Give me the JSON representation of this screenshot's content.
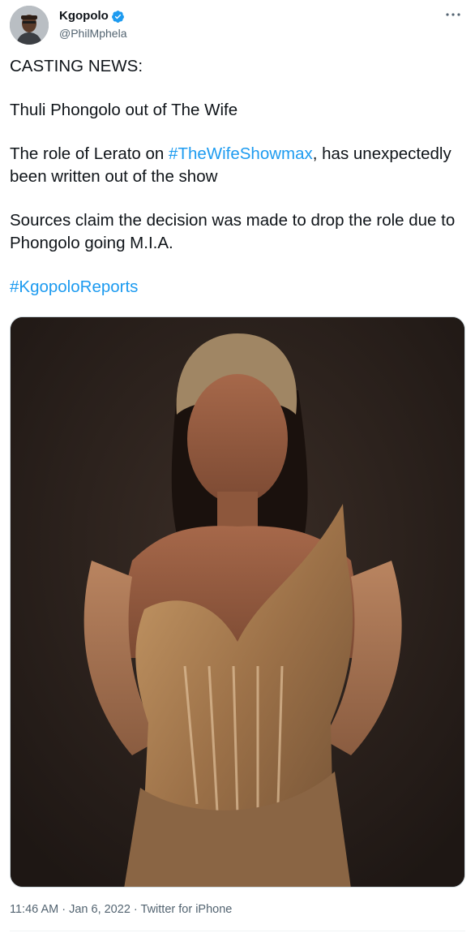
{
  "tweet": {
    "author": {
      "name": "Kgopolo",
      "handle": "@PhilMphela",
      "verified": true
    },
    "more_icon": "more-horizontal-icon",
    "line_1": "CASTING NEWS:",
    "line_2": "Thuli Phongolo out of The Wife",
    "line_3_pre": "The role of Lerato on ",
    "line_3_tag": "#TheWifeShowmax",
    "line_3_post": ", has unexpectedly been written out of the show",
    "line_4": "Sources claim the decision was made to drop the role due to Phongolo going M.I.A.",
    "line_5_tag": "#KgopoloReports",
    "media": {
      "type": "photo"
    },
    "time": "11:46 AM",
    "separator_1": " · ",
    "date": "Jan 6, 2022",
    "separator_2": " · ",
    "source": "Twitter for iPhone"
  },
  "colors": {
    "link": "#1d9bf0",
    "text": "#0f1419",
    "secondary": "#536471",
    "verified_badge": "#1d9bf0"
  }
}
